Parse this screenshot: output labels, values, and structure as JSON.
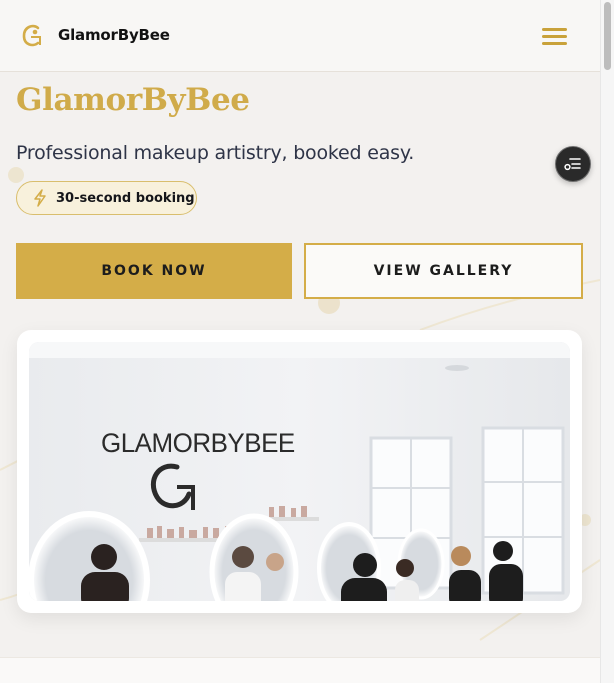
{
  "header": {
    "brand_name": "GlamorByBee",
    "logo_icon": "gb-monogram-icon",
    "menu_icon": "hamburger-menu-icon"
  },
  "hero": {
    "title": "GlamorByBee",
    "subtitle": "Professional makeup artistry, booked easy.",
    "badge": {
      "icon": "lightning-icon",
      "label": "30-second booking"
    },
    "primary_cta": "BOOK NOW",
    "secondary_cta": "VIEW GALLERY"
  },
  "floating_button": {
    "icon": "filter-list-icon"
  },
  "studio_photo": {
    "wall_text": "GLAMORBYBEE"
  },
  "colors": {
    "accent": "#d4ad48",
    "title": "#d0ab4a",
    "background": "#f3f1ef",
    "text": "#2e3447"
  }
}
